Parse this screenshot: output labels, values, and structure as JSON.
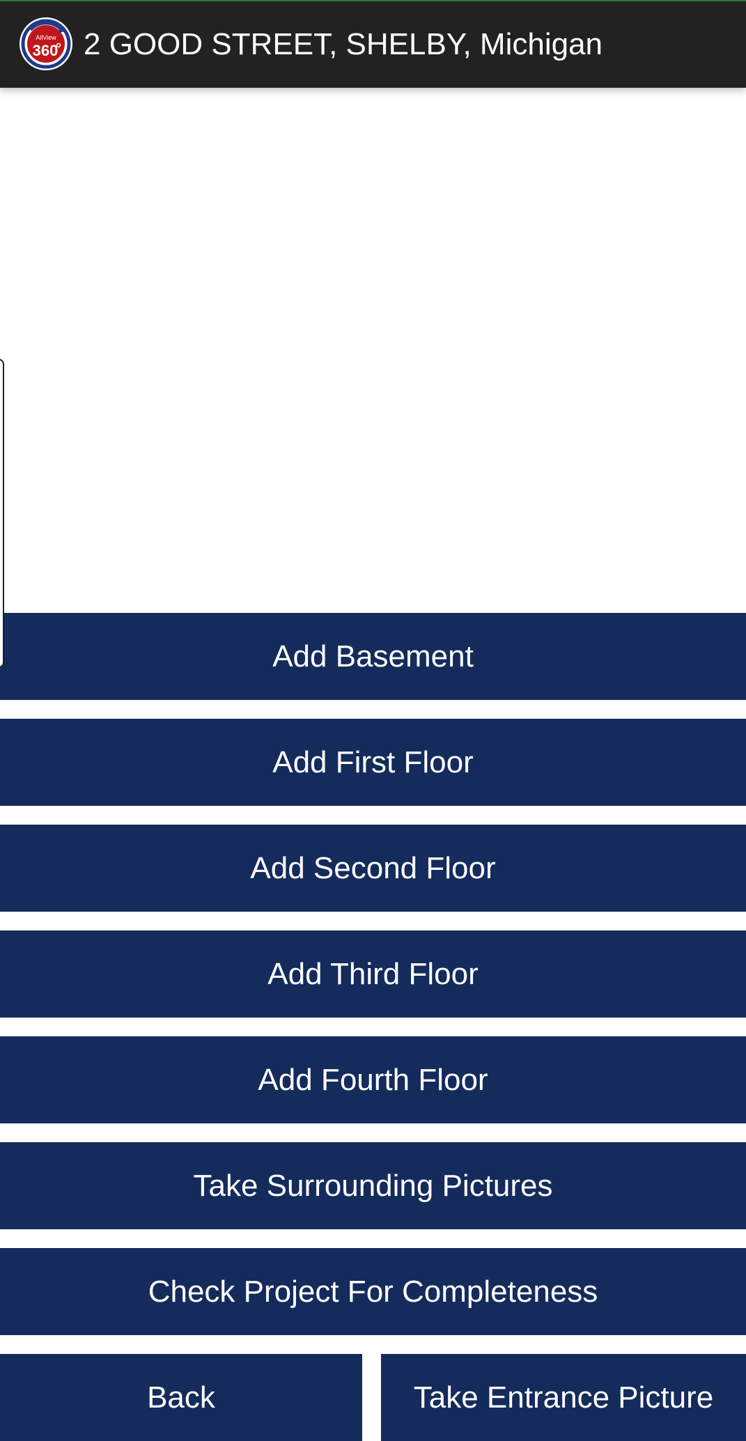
{
  "header": {
    "logo": {
      "icon": "allview-360-logo-icon",
      "brand_text": "AllView",
      "number_text": "360",
      "colors": {
        "ring": "#1f3a8a",
        "fill": "#c0171d",
        "face": "#ffffff"
      }
    },
    "title": "2 GOOD STREET, SHELBY, Michigan"
  },
  "actions": {
    "add_basement": "Add Basement",
    "add_first_floor": "Add First Floor",
    "add_second_floor": "Add Second Floor",
    "add_third_floor": "Add Third Floor",
    "add_fourth_floor": "Add Fourth Floor",
    "take_surrounding_pictures": "Take Surrounding Pictures",
    "check_completeness": "Check Project For Completeness"
  },
  "footer": {
    "back": "Back",
    "take_entrance_picture": "Take Entrance Picture"
  },
  "colors": {
    "app_bar": "#222222",
    "button": "#142b5c",
    "button_text": "#ffffff",
    "background": "#ffffff"
  }
}
